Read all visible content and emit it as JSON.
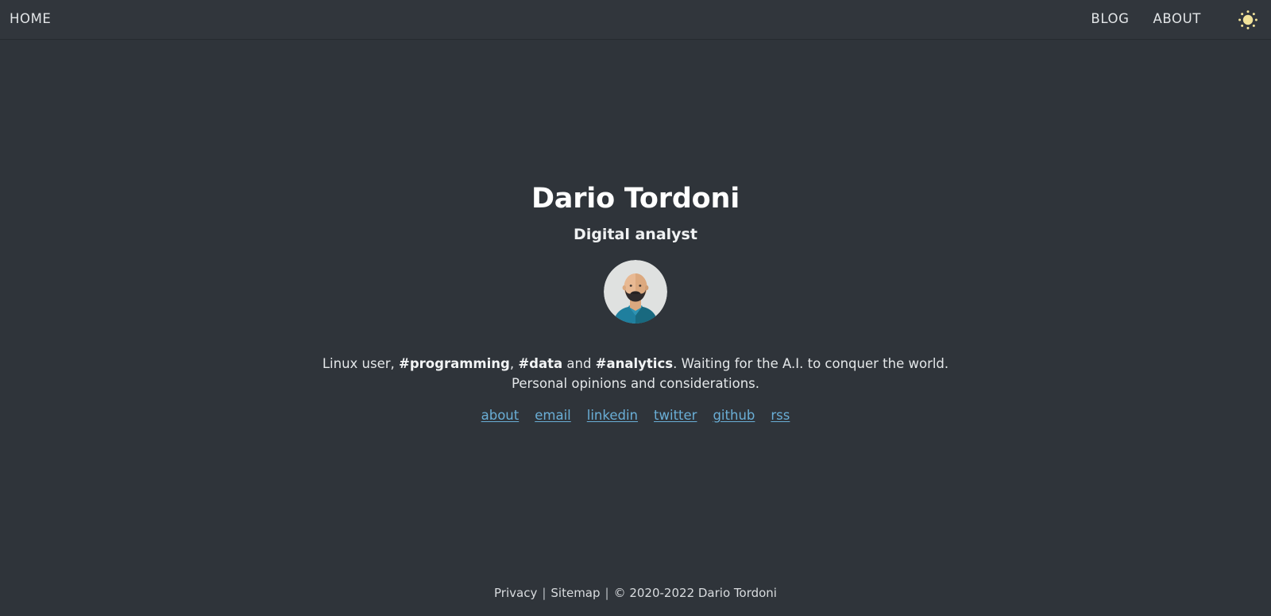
{
  "header": {
    "home_label": "HOME",
    "blog_label": "BLOG",
    "about_label": "ABOUT",
    "theme_toggle_icon": "sun-icon",
    "theme_toggle_color": "#f2e39a"
  },
  "hero": {
    "title": "Dario Tordoni",
    "subtitle": "Digital analyst",
    "avatar_icon": "avatar-illustration",
    "avatar_colors": {
      "background": "#dfe1e0",
      "skin": "#e8b993",
      "skin_shadow": "#d9a87f",
      "beard": "#2f2b2c",
      "shirt": "#1f7f9e",
      "shirt_shadow": "#19697f",
      "collar": "#2e93b3"
    }
  },
  "bio": {
    "line1_part1": "Linux user, ",
    "tag1": "#programming",
    "line1_part2": ", ",
    "tag2": "#data",
    "line1_part3": " and ",
    "tag3": "#analytics",
    "line1_part4": ". Waiting for the A.I. to conquer the world.",
    "line2": "Personal opinions and considerations."
  },
  "links": [
    {
      "label": "about",
      "name": "link-about"
    },
    {
      "label": "email",
      "name": "link-email"
    },
    {
      "label": "linkedin",
      "name": "link-linkedin"
    },
    {
      "label": "twitter",
      "name": "link-twitter"
    },
    {
      "label": "github",
      "name": "link-github"
    },
    {
      "label": "rss",
      "name": "link-rss"
    }
  ],
  "links_color": "#6aaed6",
  "footer": {
    "privacy_label": "Privacy",
    "sep1": "|",
    "sitemap_label": "Sitemap",
    "sep2": "|",
    "copyright": "© 2020-2022 Dario Tordoni"
  },
  "theme": {
    "background": "#2f343a",
    "header_background": "#31363c",
    "text": "#e8eaec"
  }
}
